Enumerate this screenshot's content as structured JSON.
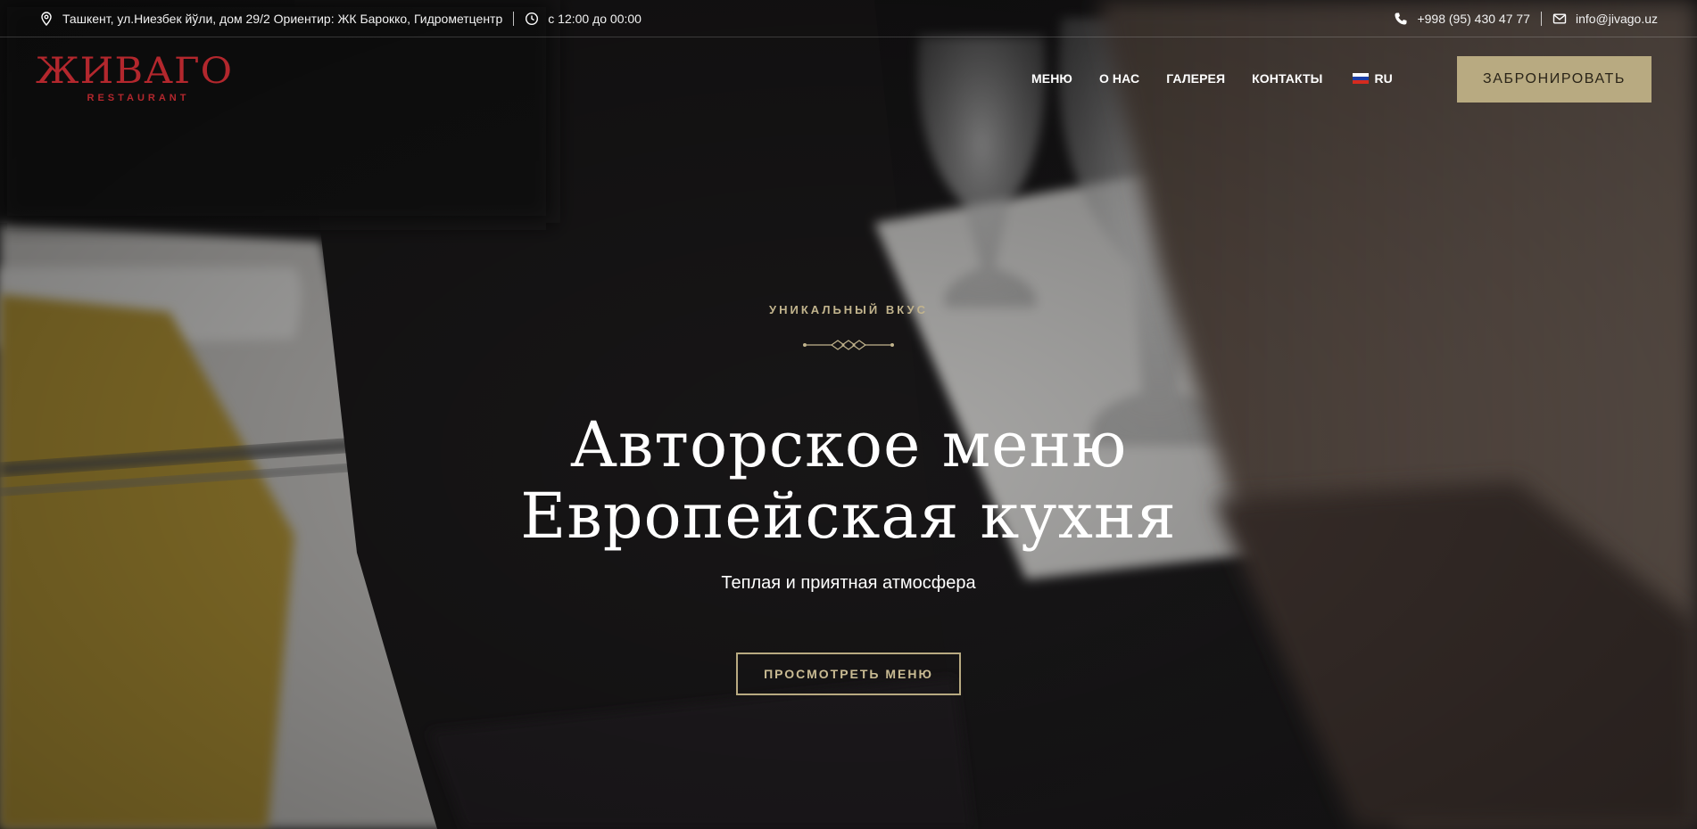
{
  "topbar": {
    "address": "Ташкент, ул.Ниезбек йўли, дом 29/2 Ориентир: ЖК Барокко, Гидрометцентр",
    "hours": "с 12:00 до 00:00",
    "phone": "+998 (95) 430 47 77",
    "email": "info@jivago.uz",
    "icons": {
      "address": "map-pin-icon",
      "hours": "clock-icon",
      "phone": "phone-icon",
      "email": "envelope-icon"
    }
  },
  "header": {
    "logo": {
      "title": "ЖИВАГО",
      "subtitle": "RESTAURANT"
    },
    "nav": [
      {
        "label": "МЕНЮ"
      },
      {
        "label": "О НАС"
      },
      {
        "label": "ГАЛЕРЕЯ"
      },
      {
        "label": "КОНТАКТЫ"
      }
    ],
    "language": {
      "label": "RU",
      "flag": "russia-flag-icon"
    },
    "book_button": "ЗАБРОНИРОВАТЬ"
  },
  "hero": {
    "eyebrow": "УНИКАЛЬНЫЙ ВКУС",
    "title_line_1": "Авторское меню",
    "title_line_2": "Европейская кухня",
    "subtitle": "Теплая и приятная атмосфера",
    "cta": "ПРОСМОТРЕТЬ МЕНЮ"
  },
  "colors": {
    "brand_red": "#b3272d",
    "accent_gold": "#b8aa81",
    "eyebrow_gold": "#c2b48d",
    "text": "#ffffff"
  }
}
